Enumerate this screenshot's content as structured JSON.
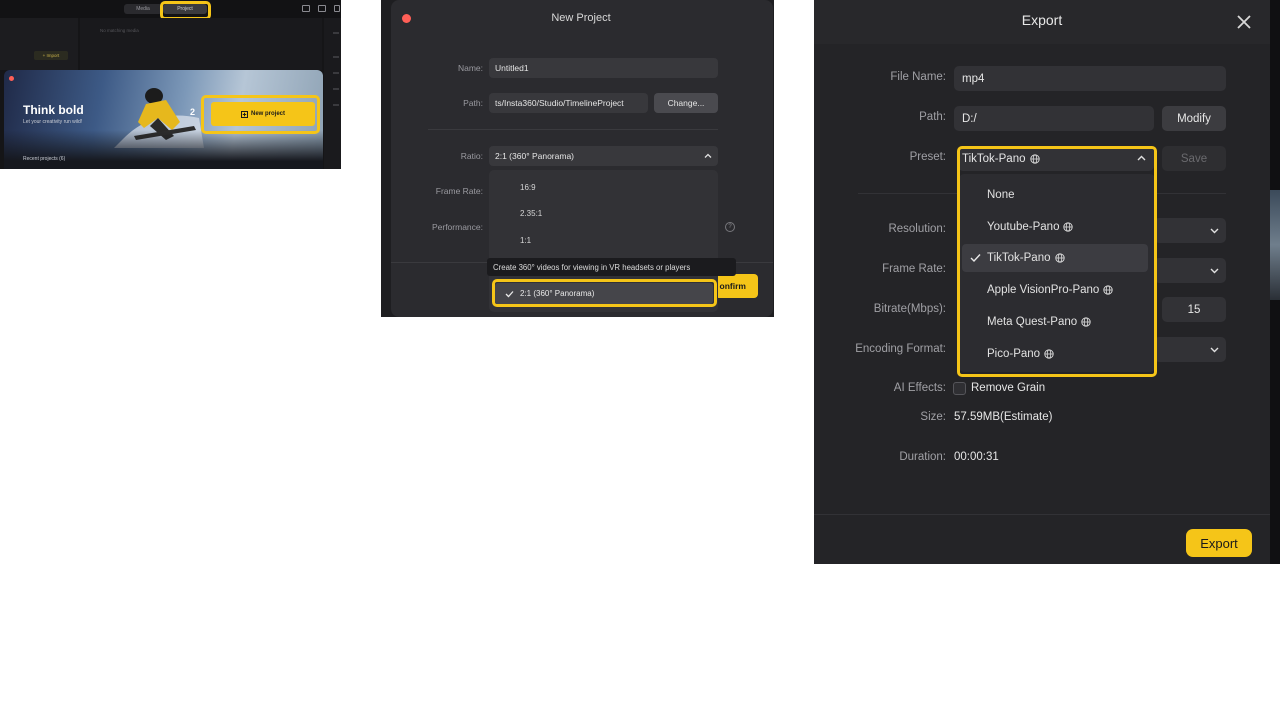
{
  "home": {
    "tabs": [
      "Media",
      "Project"
    ],
    "import_label": "+ Import",
    "placeholder_text": "No matching media",
    "hero_title": "Think bold",
    "hero_subtitle": "Let your creativity run wild!",
    "step_number": "2",
    "new_project_label": "New project",
    "recent_label": "Recent projects (6)"
  },
  "new_project": {
    "dialog_title": "New Project",
    "name_label": "Name:",
    "name_value": "Untitled1",
    "path_label": "Path:",
    "path_value": "ts/Insta360/Studio/TimelineProject",
    "change_label": "Change...",
    "ratio_label": "Ratio:",
    "ratio_value": "2:1 (360° Panorama)",
    "frame_rate_label": "Frame Rate:",
    "performance_label": "Performance:",
    "ratio_options": [
      "16:9",
      "2.35:1",
      "1:1"
    ],
    "tooltip": "Create 360° videos for viewing in VR headsets or players",
    "selected_option": "2:1 (360° Panorama)",
    "confirm_label": "onfirm"
  },
  "export": {
    "dialog_title": "Export",
    "file_name_label": "File Name:",
    "file_name_value": "mp4",
    "path_label": "Path:",
    "path_value": "D:/",
    "modify_label": "Modify",
    "preset_label": "Preset:",
    "preset_value": "TikTok-Pano",
    "save_label": "Save",
    "resolution_label": "Resolution:",
    "frame_rate_label": "Frame Rate:",
    "bitrate_label": "Bitrate(Mbps):",
    "bitrate_value": "15",
    "encoding_label": "Encoding Format:",
    "ai_effects_label": "AI Effects:",
    "remove_grain_label": "Remove Grain",
    "size_label": "Size:",
    "size_value": "57.59MB(Estimate)",
    "duration_label": "Duration:",
    "duration_value": "00:00:31",
    "export_label": "Export",
    "preset_options": [
      "None",
      "Youtube-Pano",
      "TikTok-Pano",
      "Apple VisionPro-Pano",
      "Meta Quest-Pano",
      "Pico-Pano"
    ],
    "selected_preset": "TikTok-Pano"
  },
  "colors": {
    "accent": "#f5c518",
    "close_dot": "#ff5f57"
  }
}
